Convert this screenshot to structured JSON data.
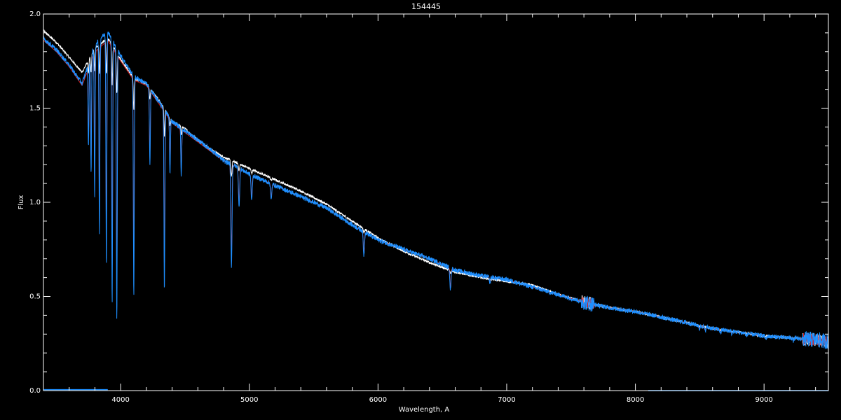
{
  "chart_data": {
    "type": "line",
    "title": "154445",
    "xlabel": "Wavelength, A",
    "ylabel": "Flux",
    "xlim": [
      3400,
      9500
    ],
    "ylim": [
      0.0,
      2.0
    ],
    "x_ticks": [
      4000,
      5000,
      6000,
      7000,
      8000,
      9000
    ],
    "x_tick_labels": [
      "4000",
      "5000",
      "6000",
      "7000",
      "8000",
      "9000"
    ],
    "y_ticks": [
      0.0,
      0.5,
      1.0,
      1.5,
      2.0
    ],
    "y_tick_labels": [
      "0.0",
      "0.5",
      "1.0",
      "1.5",
      "2.0"
    ],
    "x_minor_step": 200,
    "y_minor_step": 0.1,
    "colors": {
      "background": "#000000",
      "axes": "#ffffff",
      "observed": "#ffffff",
      "model": "#d42020",
      "fit": "#1e8fff"
    },
    "series": [
      {
        "key": "observed",
        "color": "#ffffff",
        "x": [
          3400,
          3500,
          3600,
          3700,
          3800,
          3900,
          4000,
          4100,
          4200,
          4300,
          4400,
          4500,
          4600,
          4700,
          4800,
          4900,
          5000,
          5200,
          5400,
          5600,
          5800,
          6000,
          6200,
          6400,
          6600,
          6800,
          7000,
          7200,
          7400,
          7600,
          7800,
          8000,
          8200,
          8400,
          8600,
          8800,
          9000,
          9200,
          9400,
          9500
        ],
        "y": [
          1.91,
          1.85,
          1.77,
          1.69,
          1.82,
          1.87,
          1.76,
          1.66,
          1.63,
          1.54,
          1.43,
          1.39,
          1.33,
          1.28,
          1.24,
          1.21,
          1.18,
          1.12,
          1.06,
          0.99,
          0.9,
          0.81,
          0.74,
          0.68,
          0.63,
          0.6,
          0.58,
          0.56,
          0.51,
          0.47,
          0.44,
          0.42,
          0.39,
          0.36,
          0.33,
          0.31,
          0.29,
          0.28,
          0.27,
          0.26
        ]
      },
      {
        "key": "model",
        "color": "#d42020",
        "x": [
          3400,
          3500,
          3600,
          3700,
          3800,
          3900,
          4000,
          4100,
          4200,
          4300,
          4400,
          4500,
          4600,
          4700,
          4800,
          4900,
          5000,
          5200,
          5400,
          5600,
          5800,
          6000,
          6200,
          6400,
          6600,
          6800,
          7000,
          7200,
          7400,
          7600,
          7800,
          8000,
          8200,
          8400,
          8600,
          8800,
          9000,
          9200,
          9400,
          9500
        ],
        "y": [
          1.86,
          1.8,
          1.72,
          1.62,
          1.8,
          1.86,
          1.75,
          1.65,
          1.62,
          1.52,
          1.42,
          1.37,
          1.32,
          1.27,
          1.22,
          1.19,
          1.15,
          1.09,
          1.03,
          0.97,
          0.88,
          0.8,
          0.75,
          0.7,
          0.64,
          0.61,
          0.59,
          0.55,
          0.51,
          0.47,
          0.44,
          0.42,
          0.39,
          0.36,
          0.33,
          0.31,
          0.29,
          0.28,
          0.27,
          0.26
        ]
      },
      {
        "key": "fit",
        "color": "#1e8fff",
        "x": [
          3400,
          3500,
          3600,
          3700,
          3800,
          3900,
          4000,
          4100,
          4200,
          4300,
          4400,
          4500,
          4600,
          4700,
          4800,
          4900,
          5000,
          5200,
          5400,
          5600,
          5800,
          6000,
          6200,
          6400,
          6600,
          6800,
          7000,
          7200,
          7400,
          7600,
          7800,
          8000,
          8200,
          8400,
          8600,
          8800,
          9000,
          9200,
          9400,
          9500
        ],
        "y": [
          1.87,
          1.81,
          1.73,
          1.63,
          1.84,
          1.91,
          1.78,
          1.67,
          1.63,
          1.53,
          1.43,
          1.38,
          1.33,
          1.28,
          1.22,
          1.19,
          1.15,
          1.09,
          1.03,
          0.97,
          0.88,
          0.8,
          0.75,
          0.7,
          0.64,
          0.61,
          0.59,
          0.55,
          0.51,
          0.47,
          0.44,
          0.42,
          0.39,
          0.36,
          0.33,
          0.31,
          0.29,
          0.28,
          0.27,
          0.26
        ]
      }
    ],
    "absorption_lines": [
      {
        "x": 3750,
        "depth": 0.25
      },
      {
        "x": 3770,
        "depth": 0.35
      },
      {
        "x": 3798,
        "depth": 0.45
      },
      {
        "x": 3835,
        "depth": 0.55
      },
      {
        "x": 3889,
        "depth": 0.65
      },
      {
        "x": 3934,
        "depth": 0.75
      },
      {
        "x": 3970,
        "depth": 0.8
      },
      {
        "x": 4102,
        "depth": 0.7
      },
      {
        "x": 4227,
        "depth": 0.25
      },
      {
        "x": 4340,
        "depth": 0.65
      },
      {
        "x": 4383,
        "depth": 0.2
      },
      {
        "x": 4471,
        "depth": 0.18
      },
      {
        "x": 4861,
        "depth": 0.45
      },
      {
        "x": 4920,
        "depth": 0.18
      },
      {
        "x": 5018,
        "depth": 0.12
      },
      {
        "x": 5170,
        "depth": 0.08
      },
      {
        "x": 5890,
        "depth": 0.15
      },
      {
        "x": 6563,
        "depth": 0.18
      },
      {
        "x": 6870,
        "depth": 0.05
      },
      {
        "x": 8498,
        "depth": 0.05
      },
      {
        "x": 8542,
        "depth": 0.06
      },
      {
        "x": 8662,
        "depth": 0.06
      },
      {
        "x": 8750,
        "depth": 0.04
      },
      {
        "x": 8863,
        "depth": 0.05
      },
      {
        "x": 9015,
        "depth": 0.06
      },
      {
        "x": 9229,
        "depth": 0.05
      }
    ],
    "noise_regions": [
      {
        "x0": 7580,
        "x1": 7680,
        "amp": 0.03
      },
      {
        "x0": 9300,
        "x1": 9500,
        "amp": 0.03
      }
    ],
    "baseline_segments": [
      {
        "x": [
          3400,
          3900
        ],
        "y": 0.005
      },
      {
        "x": [
          8100,
          9500
        ],
        "y": 0.0
      }
    ]
  }
}
